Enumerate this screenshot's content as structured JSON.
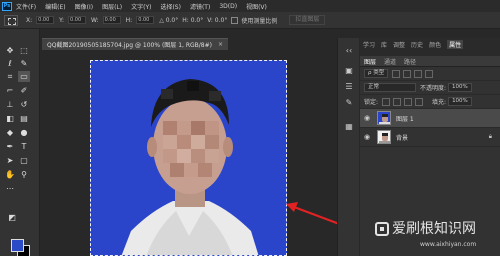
{
  "app": {
    "logo_text": "Ps"
  },
  "menu": [
    "文件(F)",
    "编辑(E)",
    "图像(I)",
    "图层(L)",
    "文字(Y)",
    "选择(S)",
    "滤镜(T)",
    "3D(D)",
    "视图(V)"
  ],
  "options": {
    "x_label": "X:",
    "x_value": "0.00",
    "y_label": "Y:",
    "y_value": "0.00",
    "w_label": "W:",
    "w_value": "0.00",
    "h_label": "H:",
    "h_value": "0.00",
    "angle_label": "△ 0.0°",
    "h2_label": "H: 0.0°",
    "v2_label": "V: 0.0°",
    "checkbox_label": "使用测量比例",
    "button_label": "拉直图层"
  },
  "document": {
    "tab_title": "QQ截图20190505185704.jpg @ 100% (图层 1, RGB/8#)",
    "close_glyph": "×"
  },
  "colors": {
    "foreground": "#2b4bc6",
    "background": "#000000",
    "photo_bg": "#2a45c9"
  },
  "panel": {
    "tabs": [
      "学习",
      "库",
      "调整",
      "历史",
      "颜色",
      "属性"
    ],
    "active_tab": "属性",
    "layers_tabs": [
      "图层",
      "通道",
      "路径"
    ],
    "filter_label": "ρ 类型",
    "blend_mode": "正常",
    "opacity_label": "不透明度:",
    "opacity_value": "100%",
    "lock_label": "锁定:",
    "fill_label": "填充:",
    "fill_value": "100%",
    "layers": [
      {
        "name": "图层 1",
        "active": true
      },
      {
        "name": "背景",
        "active": false
      }
    ]
  },
  "watermark": {
    "text": "爱刷根知识网",
    "url": "www.aixhiyan.com"
  },
  "icons": [
    "move-icon",
    "marquee-icon",
    "lasso-icon",
    "quick-select-icon",
    "crop-icon",
    "eyedropper-icon",
    "brush-icon",
    "stamp-icon",
    "eraser-icon",
    "gradient-icon",
    "pen-icon",
    "type-icon",
    "path-select-icon",
    "hand-icon",
    "zoom-icon",
    "eye-icon",
    "lock-icon",
    "arrow-icon"
  ]
}
